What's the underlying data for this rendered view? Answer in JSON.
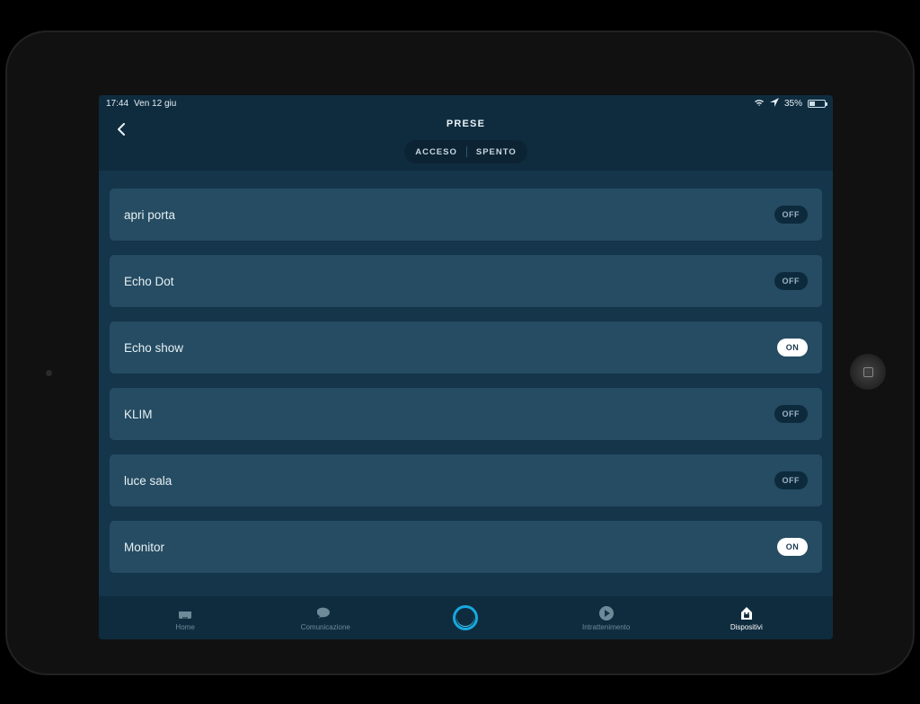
{
  "status": {
    "time": "17:44",
    "date": "Ven 12 giu",
    "battery_pct": "35%",
    "battery_fill_pct": 35
  },
  "header": {
    "title": "PRESE",
    "segment": {
      "on_label": "ACCESO",
      "off_label": "SPENTO"
    }
  },
  "devices": [
    {
      "name": "apri porta",
      "state": "OFF",
      "on": false
    },
    {
      "name": "Echo Dot",
      "state": "OFF",
      "on": false
    },
    {
      "name": "Echo show",
      "state": "ON",
      "on": true
    },
    {
      "name": "KLIM",
      "state": "OFF",
      "on": false
    },
    {
      "name": "luce sala",
      "state": "OFF",
      "on": false
    },
    {
      "name": "Monitor",
      "state": "ON",
      "on": true
    }
  ],
  "nav": {
    "home": "Home",
    "comms": "Comunicazione",
    "entertainment": "Intrattenimento",
    "devices": "Dispositivi"
  }
}
